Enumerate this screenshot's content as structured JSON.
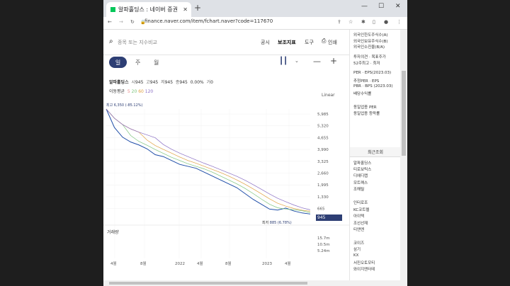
{
  "browser": {
    "tab_title": "알파홀딩스 : 네이버 증권",
    "new_tab": "+",
    "url": "finance.naver.com/item/fchart.naver?code=117670",
    "controls": {
      "minimize": "—",
      "maximize": "☐",
      "close": "✕"
    }
  },
  "search": {
    "placeholder": "종목 또는 지수비교",
    "actions": [
      "공시",
      "보조지표",
      "도구",
      "인쇄"
    ]
  },
  "periods": {
    "day": "일",
    "week": "주",
    "month": "월"
  },
  "stock": {
    "name": "알파홀딩스",
    "open_label": "시",
    "open": "945",
    "high_label": "고",
    "high": "945",
    "low_label": "저",
    "low": "945",
    "close_label": "종",
    "close": "945",
    "change": "0.00%",
    "volume_label": "거",
    "volume": "0",
    "ma_label": "이동평균",
    "ma_periods": [
      "5",
      "20",
      "60",
      "120"
    ],
    "ma_colors": [
      "#e88a8a",
      "#7cc47c",
      "#e0a040",
      "#8a6ec4"
    ],
    "scale": "Linear",
    "high_note": "최고 6,350 (-85.12%)",
    "low_note_label": "최저",
    "low_note_value": "885 (6.78%)",
    "price_badge": "945"
  },
  "chart_data": {
    "type": "line",
    "y_ticks": [
      "5,985",
      "5,320",
      "4,655",
      "3,990",
      "3,325",
      "2,660",
      "1,995",
      "1,330",
      "665"
    ],
    "x_ticks": [
      "4월",
      "8월",
      "2022",
      "4월",
      "8월",
      "2023",
      "4월"
    ],
    "volume_title": "거래량",
    "volume_ticks": [
      "15.7m",
      "10.5m",
      "5.24m"
    ],
    "ylim": [
      665,
      6350
    ],
    "series": [
      {
        "values": [
          6350,
          5400,
          4900,
          4650,
          4500,
          4300,
          4000,
          3900,
          3700,
          3500,
          3400,
          3300,
          3100,
          2900,
          2700,
          2500,
          2300,
          2000,
          1700,
          1450,
          1200,
          1150,
          1250,
          1100,
          1000,
          945
        ]
      }
    ]
  },
  "sidebar": {
    "info": [
      "외국인한도주식수(A)",
      "외국인보유주식수(B)",
      "외국인소진율(B/A)",
      "투자의견 · 목표주가",
      "52주최고 · 최저",
      "PER · EPS(2023.03)",
      "추정PER · EPS",
      "PBR · BPS (2023.03)",
      "배당수익률",
      "동일업종 PER",
      "동일업종 등락률"
    ],
    "recent_title": "최근조회",
    "recent": [
      "알파홀딩스",
      "티로보틱스",
      "디에디랩",
      "모트렉스",
      "조해릴",
      "인터로조",
      "KC코트렐",
      "아이텍",
      "조선선재",
      "티앤엔",
      "코이즈",
      "삼기",
      "KX",
      "서진오토모티",
      "와이지엔터테"
    ]
  }
}
